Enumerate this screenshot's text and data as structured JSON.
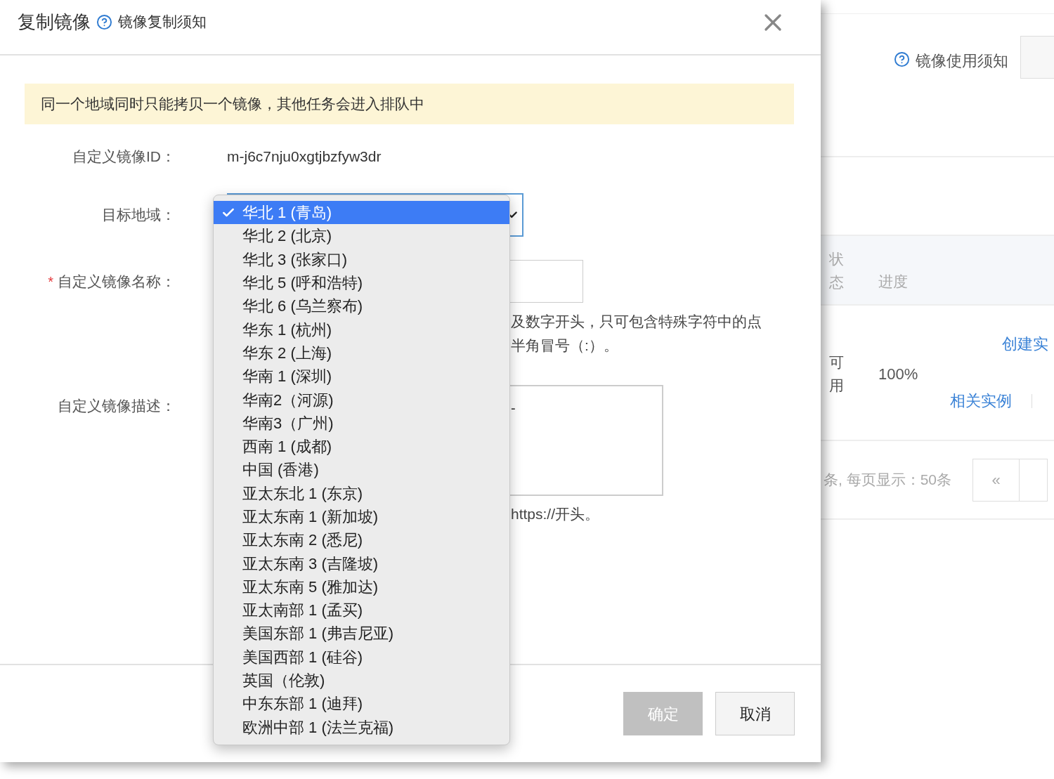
{
  "dialog": {
    "title": "复制镜像",
    "help_link": "镜像复制须知",
    "alert": "同一个地域同时只能拷贝一个镜像，其他任务会进入排队中",
    "fields": [
      {
        "kind": "text",
        "label": "自定义镜像ID：",
        "value": "m-j6c7nju0xgtjbzfyw3dr"
      },
      {
        "kind": "select",
        "label": "目标地域：",
        "options": [
          {
            "label": "华北 1 (青岛)",
            "selected": true
          },
          {
            "label": "华北 2 (北京)",
            "selected": false
          },
          {
            "label": "华北 3 (张家口)",
            "selected": false
          },
          {
            "label": "华北 5 (呼和浩特)",
            "selected": false
          },
          {
            "label": "华北 6 (乌兰察布)",
            "selected": false
          },
          {
            "label": "华东 1 (杭州)",
            "selected": false
          },
          {
            "label": "华东 2 (上海)",
            "selected": false
          },
          {
            "label": "华南 1 (深圳)",
            "selected": false
          },
          {
            "label": "华南2（河源)",
            "selected": false
          },
          {
            "label": "华南3（广州)",
            "selected": false
          },
          {
            "label": "西南 1 (成都)",
            "selected": false
          },
          {
            "label": "中国 (香港)",
            "selected": false
          },
          {
            "label": "亚太东北 1 (东京)",
            "selected": false
          },
          {
            "label": "亚太东南 1 (新加坡)",
            "selected": false
          },
          {
            "label": "亚太东南 2 (悉尼)",
            "selected": false
          },
          {
            "label": "亚太东南 3 (吉隆坡)",
            "selected": false
          },
          {
            "label": "亚太东南 5 (雅加达)",
            "selected": false
          },
          {
            "label": "亚太南部 1 (孟买)",
            "selected": false
          },
          {
            "label": "美国东部 1 (弗吉尼亚)",
            "selected": false
          },
          {
            "label": "美国西部 1 (硅谷)",
            "selected": false
          },
          {
            "label": "英国（伦敦)",
            "selected": false
          },
          {
            "label": "中东东部 1 (迪拜)",
            "selected": false
          },
          {
            "label": "欧洲中部 1 (法兰克福)",
            "selected": false
          }
        ]
      },
      {
        "kind": "input",
        "label": "自定义镜像名称：",
        "required_mark": "*",
        "hint_lines": [
          "及数字开头，只可包含特殊字符中的点",
          "半角冒号（:）。"
        ]
      },
      {
        "kind": "textarea",
        "label": "自定义镜像描述：",
        "value": "-",
        "hint_lines": [
          "https://开头。"
        ]
      }
    ],
    "buttons": [
      {
        "label": "确定",
        "disabled": true
      },
      {
        "label": "取消",
        "disabled": false
      }
    ]
  },
  "background": {
    "help_link": "镜像使用须知",
    "table": {
      "columns": [
        "状态",
        "进度"
      ],
      "rows": [
        {
          "status": "可用",
          "progress": "100%",
          "actions": [
            "创建实",
            "相关实例"
          ]
        }
      ]
    },
    "pagination": {
      "summary": "条, 每页显示：50条",
      "prev": "«"
    }
  }
}
